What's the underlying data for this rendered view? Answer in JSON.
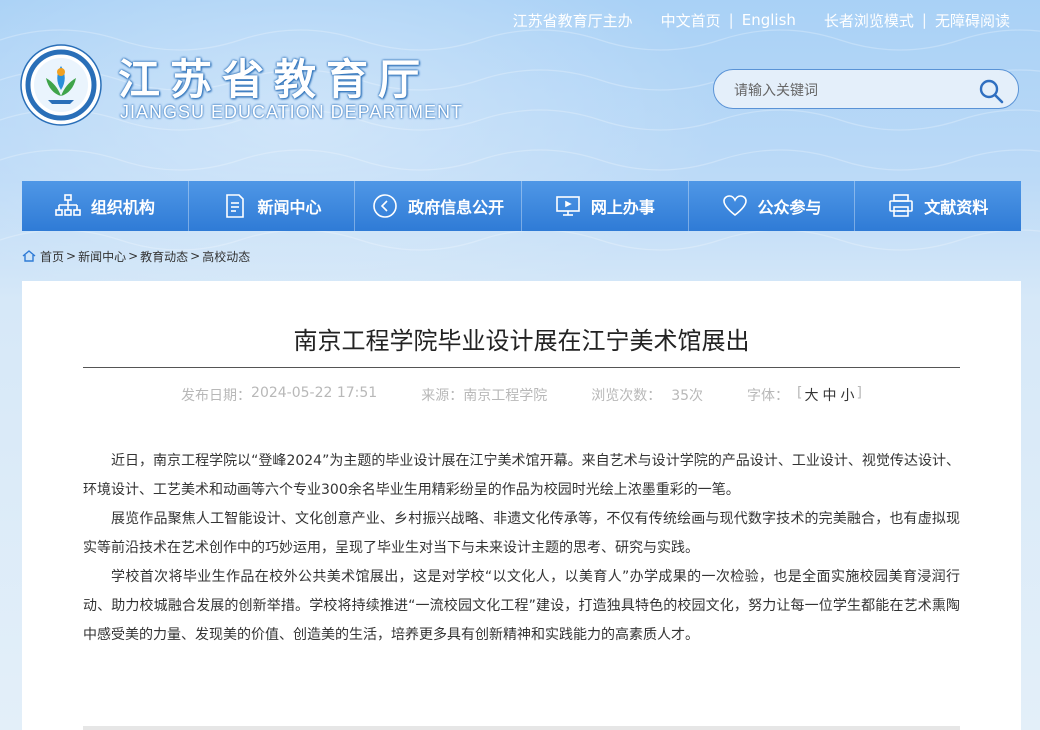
{
  "toplinks": {
    "host": "江苏省教育厅主办",
    "home_cn": "中文首页",
    "english": "English",
    "elder_mode": "长者浏览模式",
    "accessible": "无障碍阅读"
  },
  "header": {
    "title": "江苏省教育厅",
    "subtitle": "JIANGSU EDUCATION DEPARTMENT"
  },
  "search": {
    "placeholder": "请输入关键词",
    "icon": "search-icon"
  },
  "nav": {
    "items": [
      {
        "label": "组织机构",
        "icon": "org-chart-icon"
      },
      {
        "label": "新闻中心",
        "icon": "document-icon"
      },
      {
        "label": "政府信息公开",
        "icon": "play-circle-icon"
      },
      {
        "label": "网上办事",
        "icon": "monitor-icon"
      },
      {
        "label": "公众参与",
        "icon": "heart-icon"
      },
      {
        "label": "文献资料",
        "icon": "printer-icon"
      }
    ]
  },
  "breadcrumb": {
    "items": [
      "首页",
      "新闻中心",
      "教育动态",
      "高校动态"
    ],
    "separator": ">"
  },
  "article": {
    "title": "南京工程学院毕业设计展在江宁美术馆展出",
    "meta": {
      "date_label": "发布日期：",
      "date": "2024-05-22 17:51",
      "source_label": "来源：",
      "source": "南京工程学院",
      "views_label": "浏览次数：",
      "views": "35次",
      "font_label": "字体：",
      "font_open": "[",
      "font_big": "大",
      "font_mid": "中",
      "font_small": "小",
      "font_close": "]"
    },
    "paragraphs": [
      "近日，南京工程学院以“登峰2024”为主题的毕业设计展在江宁美术馆开幕。来自艺术与设计学院的产品设计、工业设计、视觉传达设计、环境设计、工艺美术和动画等六个专业300余名毕业生用精彩纷呈的作品为校园时光绘上浓墨重彩的一笔。",
      "展览作品聚焦人工智能设计、文化创意产业、乡村振兴战略、非遗文化传承等，不仅有传统绘画与现代数字技术的完美融合，也有虚拟现实等前沿技术在艺术创作中的巧妙运用，呈现了毕业生对当下与未来设计主题的思考、研究与实践。",
      "学校首次将毕业生作品在校外公共美术馆展出，这是对学校“以文化人，以美育人”办学成果的一次检验，也是全面实施校园美育浸润行动、助力校城融合发展的创新举措。学校将持续推进“一流校园文化工程”建设，打造独具特色的校园文化，努力让每一位学生都能在艺术熏陶中感受美的力量、发现美的价值、创造美的生活，培养更多具有创新精神和实践能力的高素质人才。"
    ]
  },
  "colors": {
    "nav_bg": "#3a86dc",
    "accent": "#2f7bd6",
    "text": "#333333"
  }
}
